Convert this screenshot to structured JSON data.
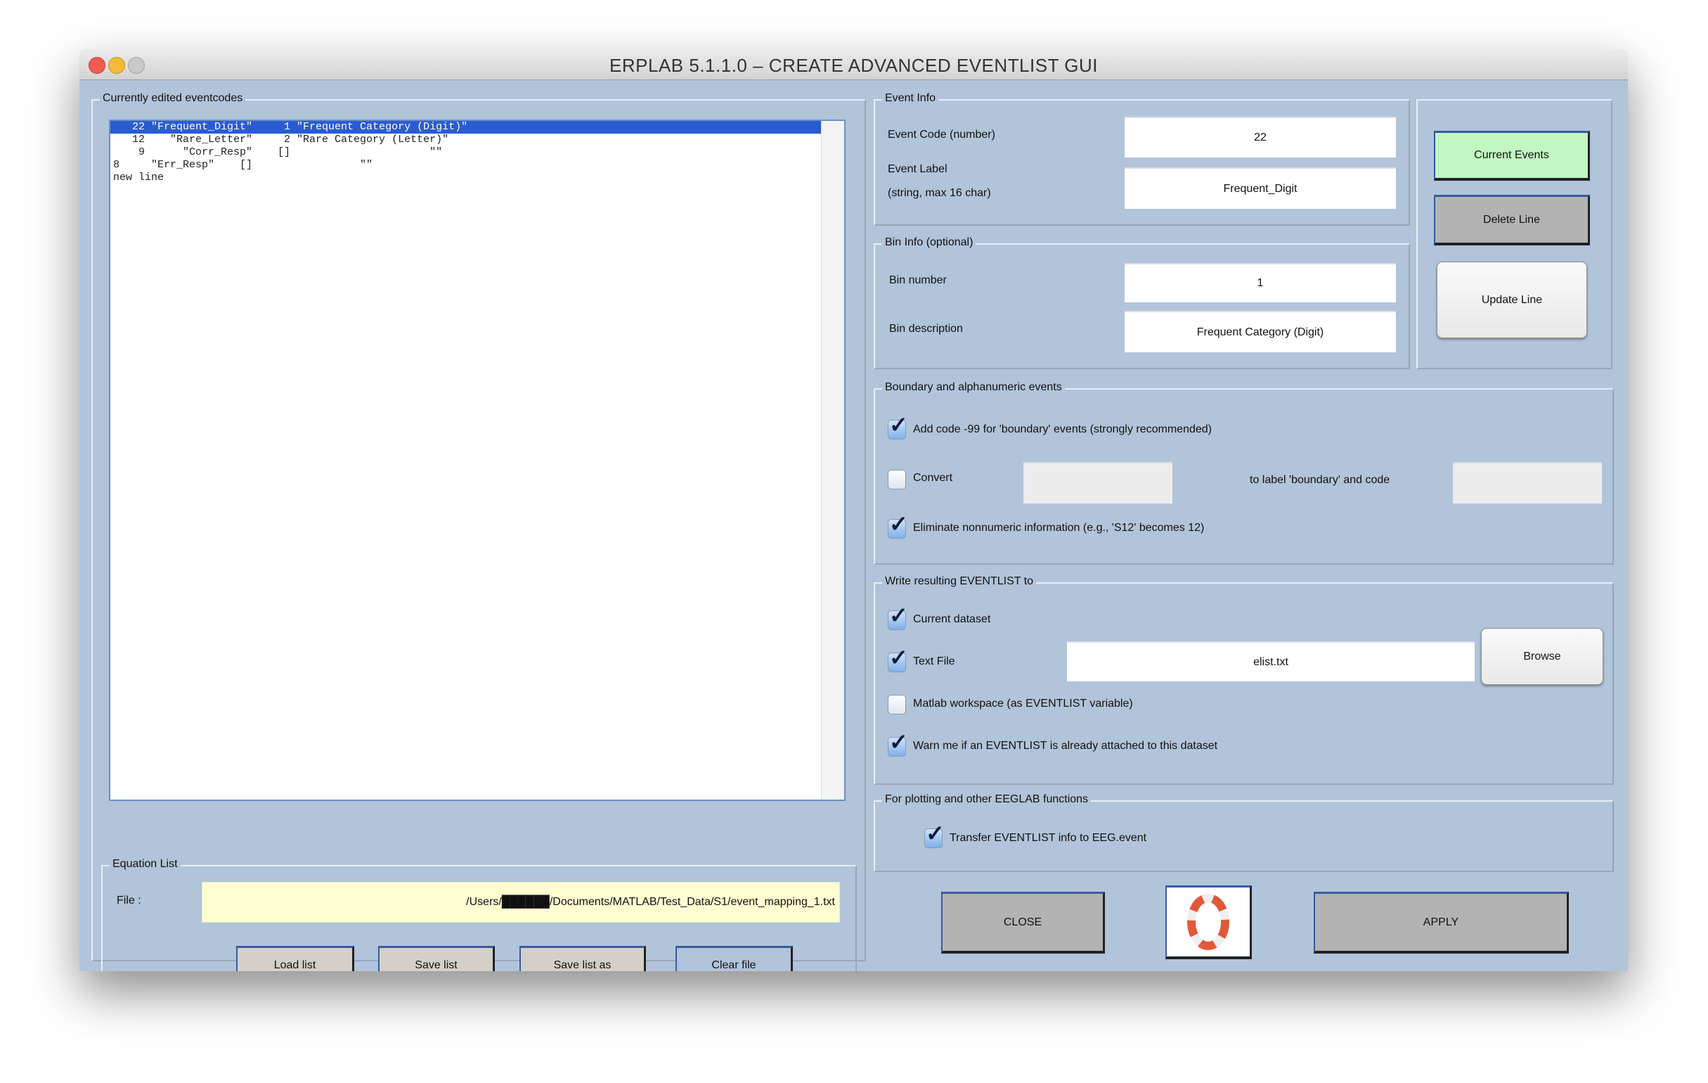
{
  "window": {
    "title": "ERPLAB 5.1.1.0   –   CREATE ADVANCED EVENTLIST GUI"
  },
  "eventcodes": {
    "group_label": "Currently edited eventcodes",
    "rows": [
      "   22 \"Frequent_Digit\"     1 \"Frequent Category (Digit)\"",
      "   12    \"Rare_Letter\"     2 \"Rare Category (Letter)\"",
      "    9      \"Corr_Resp\"    []                      \"\"",
      "8     \"Err_Resp\"    []                 \"\"",
      "new line"
    ],
    "selected_index": 0
  },
  "equation_list": {
    "group_label": "Equation List",
    "file_label": "File :",
    "file_value": "/Users/██████/Documents/MATLAB/Test_Data/S1/event_mapping_1.txt",
    "buttons": {
      "load": "Load list",
      "save": "Save list",
      "save_as": "Save list as",
      "clear": "Clear file"
    }
  },
  "event_info": {
    "group_label": "Event Info",
    "code_label": "Event Code (number)",
    "code_value": "22",
    "label_label": "Event Label",
    "label_hint": "(string, max 16 char)",
    "label_value": "Frequent_Digit"
  },
  "bin_info": {
    "group_label": "Bin Info (optional)",
    "number_label": "Bin number",
    "number_value": "1",
    "desc_label": "Bin description",
    "desc_value": "Frequent Category (Digit)"
  },
  "actions": {
    "current_events": "Current Events",
    "delete_line": "Delete Line",
    "update_line": "Update Line",
    "current_events_color": "#c1f7c1"
  },
  "boundary": {
    "group_label": "Boundary and alphanumeric events",
    "add_code": {
      "label": "Add code -99 for 'boundary' events (strongly recommended)",
      "checked": true
    },
    "convert": {
      "label": "Convert",
      "checked": false,
      "value": ""
    },
    "to_label": "to label 'boundary' and code",
    "code_value": "",
    "eliminate": {
      "label": "Eliminate nonnumeric information (e.g., 'S12' becomes 12)",
      "checked": true
    }
  },
  "write": {
    "group_label": "Write resulting EVENTLIST to",
    "current_dataset": {
      "label": "Current dataset",
      "checked": true
    },
    "text_file": {
      "label": "Text File",
      "checked": true,
      "value": "elist.txt"
    },
    "browse": "Browse",
    "workspace": {
      "label": "Matlab workspace (as EVENTLIST variable)",
      "checked": false
    },
    "warn": {
      "label": "Warn me if an EVENTLIST is already attached to this dataset",
      "checked": true
    }
  },
  "plotting": {
    "group_label": "For plotting and other EEGLAB functions",
    "transfer": {
      "label": "Transfer EVENTLIST info to EEG.event",
      "checked": true
    }
  },
  "footer": {
    "close": "CLOSE",
    "help_icon": "lifebuoy-icon",
    "apply": "APPLY"
  }
}
